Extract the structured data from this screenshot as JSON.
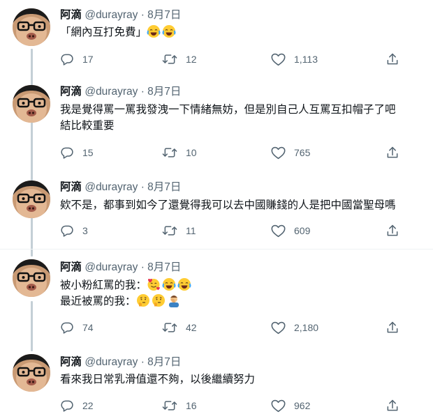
{
  "tweets": [
    {
      "name": "阿滴",
      "handle": "@durayray",
      "dot": "·",
      "date": "8月7日",
      "lines": [
        {
          "text": "「網內互打免費」",
          "emojis": [
            "joy-emoji",
            "joy-emoji"
          ]
        }
      ],
      "replies": "17",
      "retweets": "12",
      "likes": "1,113"
    },
    {
      "name": "阿滴",
      "handle": "@durayray",
      "dot": "·",
      "date": "8月7日",
      "lines": [
        {
          "text": "我是覺得罵一罵我發洩一下情緒無妨，但是別自己人互罵互扣帽子了吧",
          "emojis": []
        },
        {
          "text": "結比較重要",
          "emojis": []
        }
      ],
      "replies": "15",
      "retweets": "10",
      "likes": "765"
    },
    {
      "name": "阿滴",
      "handle": "@durayray",
      "dot": "·",
      "date": "8月7日",
      "lines": [
        {
          "text": "欸不是，都事到如今了還覺得我可以去中國賺錢的人是把中國當聖母嗎",
          "emojis": []
        }
      ],
      "replies": "3",
      "retweets": "11",
      "likes": "609"
    },
    {
      "name": "阿滴",
      "handle": "@durayray",
      "dot": "·",
      "date": "8月7日",
      "lines": [
        {
          "text": "被小粉紅罵的我：",
          "emojis": [
            "smiling-hearts-emoji",
            "joy-emoji",
            "joy-emoji"
          ]
        },
        {
          "text": "最近被罵的我：",
          "emojis": [
            "thinking-emoji",
            "thinking-emoji",
            "facepalm-emoji"
          ]
        }
      ],
      "replies": "74",
      "retweets": "42",
      "likes": "2,180"
    },
    {
      "name": "阿滴",
      "handle": "@durayray",
      "dot": "·",
      "date": "8月7日",
      "lines": [
        {
          "text": "看來我日常乳滑值還不夠，以後繼續努力",
          "emojis": []
        }
      ],
      "replies": "22",
      "retweets": "16",
      "likes": "962"
    }
  ],
  "icons": {
    "reply": "reply-icon",
    "retweet": "retweet-icon",
    "like": "heart-icon",
    "share": "share-icon"
  },
  "colors": {
    "text": "#0f1419",
    "secondary": "#536471",
    "thread_line": "#c4cfd6",
    "divider": "#eff3f4"
  }
}
